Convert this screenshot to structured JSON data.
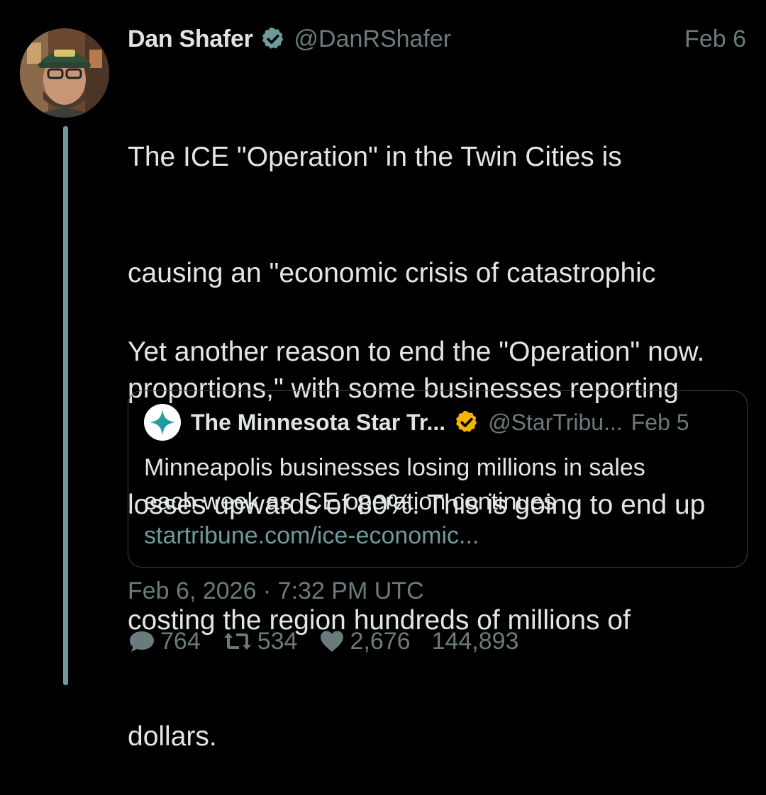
{
  "post": {
    "author_name": "Dan Shafer",
    "handle": "@DanRShafer",
    "date": "Feb 6",
    "verified_icon": "verified-badge-icon",
    "body_paragraph_1_lines": [
      "The ICE \"Operation\" in the Twin Cities is",
      "causing an \"economic crisis of catastrophic",
      "proportions,\" with some businesses reporting",
      "losses upwards of 80%. This is going to end up",
      "costing the region hundreds of millions of",
      "dollars."
    ],
    "body_paragraph_2": "Yet another reason to end the \"Operation\" now.",
    "timestamp": "Feb 6, 2026 · 7:32 PM UTC"
  },
  "quote": {
    "author_name": "The Minnesota Star Tr...",
    "handle": "@StarTribu...",
    "date": "Feb 5",
    "text_line_1": "Minneapolis businesses losing millions in sales",
    "text_line_2": "each week as ICE operation continues",
    "link": "startribune.com/ice-economic...",
    "verified_color": "#f4b400"
  },
  "stats": {
    "replies": "764",
    "retweets": "534",
    "likes": "2,676",
    "views": "144,893"
  },
  "colors": {
    "background": "#000000",
    "text": "#e2e6e6",
    "muted": "#6b7b7d",
    "accent": "#6f9a9c"
  }
}
